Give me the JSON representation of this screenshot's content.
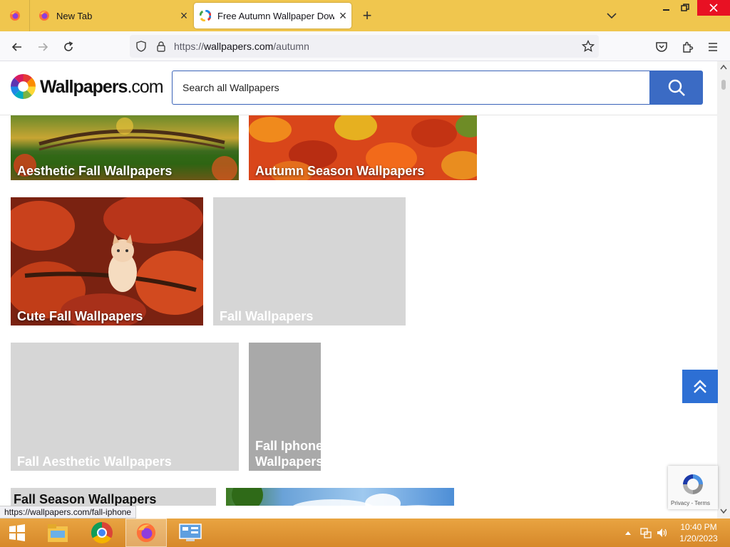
{
  "browser": {
    "tabs": [
      {
        "label": "New Tab"
      },
      {
        "label": "Free Autumn Wallpaper Downloads"
      }
    ],
    "new_tab_symbol": "+",
    "url": {
      "prefix": "https://",
      "domain": "wallpapers.com",
      "path": "/autumn"
    },
    "status_url": "https://wallpapers.com/fall-iphone"
  },
  "site": {
    "logo_bold": "Wallpapers",
    "logo_light": ".com",
    "search_placeholder": "Search all Wallpapers"
  },
  "cards": [
    {
      "title": "Aesthetic Fall Wallpapers"
    },
    {
      "title": "Autumn Season Wallpapers"
    },
    {
      "title": "Cute Fall Wallpapers"
    },
    {
      "title": "Fall Wallpapers"
    },
    {
      "title": "Fall Aesthetic Wallpapers"
    },
    {
      "title": "Fall Iphone Wallpapers"
    },
    {
      "title": "Fall Season Wallpapers"
    }
  ],
  "recaptcha": {
    "privacy": "Privacy",
    "separator": "-",
    "terms": "Terms"
  },
  "taskbar": {
    "time": "10:40 PM",
    "date": "1/20/2023"
  },
  "colors": {
    "accent": "#3b6bc4",
    "titlebar": "#f0c64e",
    "taskbar": "#e09a38",
    "scrolltop": "#2d6fd4"
  },
  "icons": [
    "firefox-icon",
    "chrome-icon",
    "close-icon",
    "plus-icon",
    "chevron-down-icon",
    "back-icon",
    "forward-icon",
    "reload-icon",
    "shield-icon",
    "lock-icon",
    "star-icon",
    "pocket-icon",
    "extensions-icon",
    "menu-icon",
    "search-icon",
    "double-chevron-up-icon",
    "windows-start-icon",
    "file-explorer-icon"
  ]
}
